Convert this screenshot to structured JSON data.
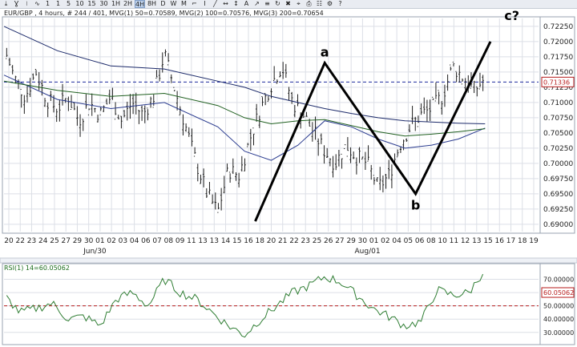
{
  "toolbar": {
    "items": [
      {
        "label": "⤓",
        "name": "download-icon",
        "interactable": true
      },
      {
        "label": "Ɣ",
        "name": "candle-type-icon",
        "interactable": true
      },
      {
        "label": "⧘",
        "name": "bar-type-icon",
        "interactable": true
      },
      {
        "label": "∿",
        "name": "line-type-icon",
        "interactable": true
      },
      {
        "label": "1",
        "name": "timeframe-1"
      },
      {
        "label": "1",
        "name": "timeframe-1b"
      },
      {
        "label": "5",
        "name": "timeframe-5"
      },
      {
        "label": "10",
        "name": "timeframe-10"
      },
      {
        "label": "15",
        "name": "timeframe-15"
      },
      {
        "label": "30",
        "name": "timeframe-30"
      },
      {
        "label": "1H",
        "name": "timeframe-1h"
      },
      {
        "label": "2H",
        "name": "timeframe-2h"
      },
      {
        "label": "4H",
        "name": "timeframe-4h",
        "active": true
      },
      {
        "label": "8H",
        "name": "timeframe-8h"
      },
      {
        "label": "D",
        "name": "timeframe-d"
      },
      {
        "label": "W",
        "name": "timeframe-w"
      },
      {
        "label": "M",
        "name": "timeframe-m"
      },
      {
        "label": "⌐",
        "name": "crosshair-icon"
      },
      {
        "label": "I",
        "name": "cursor-icon"
      },
      {
        "label": "╱",
        "name": "trendline-icon"
      },
      {
        "label": "↔",
        "name": "hline-icon"
      },
      {
        "label": "↕",
        "name": "vline-icon"
      },
      {
        "label": "A",
        "name": "text-tool-icon"
      },
      {
        "label": "↗",
        "name": "arrow-tool-icon"
      },
      {
        "label": "≡",
        "name": "fib-icon"
      },
      {
        "label": "↻",
        "name": "refresh-icon"
      },
      {
        "label": "✖",
        "name": "delete-icon"
      },
      {
        "label": "⌖",
        "name": "target-icon"
      },
      {
        "label": "⎙",
        "name": "print-icon"
      },
      {
        "label": "☷",
        "name": "grid-icon"
      },
      {
        "label": "⚙",
        "name": "settings-icon"
      },
      {
        "label": "?",
        "name": "help-icon"
      }
    ]
  },
  "colors": {
    "price": "#1c1c1c",
    "ma_blue": "#2a3b8f",
    "ma_green": "#1f5f1f",
    "ma_navy": "#1c2a6a",
    "rsi_line": "#2e7d32",
    "rsi_level": "#b71c1c",
    "last_price_line": "#1f2a9e",
    "price_tag": "#b71c1c",
    "grid": "#dcdfe6",
    "axis_bg": "#ffffff"
  },
  "chart_data": [
    {
      "type": "line",
      "title": "EUR/GBP , 4 hours, # 244 / 401, MVG(1) 50=0.70589, MVG(2) 100=0.70576, MVG(3) 200=0.70654",
      "yticks": [
        0.69,
        0.6925,
        0.695,
        0.6975,
        0.7,
        0.7025,
        0.705,
        0.7075,
        0.71,
        0.7125,
        0.715,
        0.7175,
        0.72,
        0.7225
      ],
      "ytick_labels": [
        "0.69000",
        "0.69250",
        "0.69500",
        "0.69750",
        "0.70000",
        "0.70250",
        "0.70500",
        "0.70750",
        "0.71000",
        "0.71250",
        "0.71500",
        "0.71750",
        "0.72000",
        "0.72250"
      ],
      "ylim": [
        0.6888,
        0.7238
      ],
      "xlim": [
        0,
        100
      ],
      "x_day_labels": [
        "20",
        "22",
        "23",
        "24",
        "25",
        "27",
        "29",
        "30",
        "01",
        "02",
        "03",
        "04",
        "06",
        "07",
        "08",
        "09",
        "11",
        "13",
        "13",
        "14",
        "15",
        "16",
        "18",
        "20",
        "21",
        "22",
        "23",
        "25",
        "26",
        "27",
        "29",
        "30",
        "01",
        "02",
        "04",
        "05",
        "06",
        "08",
        "10",
        "11",
        "12",
        "13",
        "15",
        "16",
        "17",
        "18",
        "19"
      ],
      "x_month_labels": [
        {
          "label": "Jun/30",
          "x": 17
        },
        {
          "label": "Aug/01",
          "x": 68
        }
      ],
      "last_price": 0.71336,
      "last_price_label": "0.71336",
      "series": [
        {
          "name": "EUR/GBP",
          "style": "ohlc",
          "x": [
            0,
            2,
            4,
            6,
            8,
            10,
            12,
            14,
            16,
            18,
            20,
            22,
            24,
            26,
            28,
            30,
            32,
            34,
            36,
            38,
            40,
            42,
            44,
            46,
            48,
            50,
            52,
            54,
            56,
            58,
            60,
            62,
            64,
            66,
            68,
            70,
            72,
            74,
            76,
            78,
            80,
            82,
            84,
            86,
            88,
            90
          ],
          "close": [
            0.719,
            0.714,
            0.711,
            0.715,
            0.7105,
            0.709,
            0.711,
            0.707,
            0.71,
            0.708,
            0.711,
            0.707,
            0.71,
            0.708,
            0.711,
            0.718,
            0.712,
            0.706,
            0.7,
            0.695,
            0.692,
            0.699,
            0.698,
            0.704,
            0.709,
            0.713,
            0.716,
            0.71,
            0.708,
            0.705,
            0.702,
            0.7,
            0.703,
            0.701,
            0.7,
            0.696,
            0.698,
            0.703,
            0.706,
            0.708,
            0.709,
            0.711,
            0.716,
            0.714,
            0.712,
            0.714
          ]
        },
        {
          "name": "MVG(1) 50",
          "x": [
            0,
            10,
            20,
            30,
            40,
            45,
            50,
            55,
            60,
            65,
            70,
            75,
            80,
            85,
            90
          ],
          "y": [
            0.7145,
            0.7105,
            0.709,
            0.71,
            0.706,
            0.702,
            0.7005,
            0.703,
            0.707,
            0.706,
            0.704,
            0.7025,
            0.703,
            0.704,
            0.7058
          ]
        },
        {
          "name": "MVG(2) 100",
          "x": [
            0,
            10,
            20,
            30,
            40,
            45,
            50,
            55,
            60,
            65,
            70,
            75,
            80,
            85,
            90
          ],
          "y": [
            0.7135,
            0.712,
            0.711,
            0.7115,
            0.7095,
            0.7075,
            0.7065,
            0.707,
            0.7072,
            0.7062,
            0.7052,
            0.7045,
            0.7048,
            0.7052,
            0.7057
          ]
        },
        {
          "name": "MVG(3) 200",
          "x": [
            0,
            10,
            20,
            30,
            40,
            45,
            50,
            55,
            60,
            65,
            70,
            75,
            80,
            85,
            90
          ],
          "y": [
            0.7225,
            0.7185,
            0.716,
            0.7155,
            0.7135,
            0.7125,
            0.711,
            0.71,
            0.709,
            0.7082,
            0.7075,
            0.707,
            0.7068,
            0.7066,
            0.7065
          ]
        }
      ],
      "annotations": [
        {
          "label": "a",
          "x": 60,
          "y": 0.7165
        },
        {
          "label": "b",
          "x": 77,
          "y": 0.6945
        },
        {
          "label": "c?",
          "x": 95,
          "y": 0.7225
        }
      ],
      "wave_lines": {
        "x": [
          47,
          60,
          77,
          91
        ],
        "y": [
          0.6905,
          0.7165,
          0.695,
          0.72
        ]
      }
    },
    {
      "type": "line",
      "title": "RSI(1) 14=60.05062",
      "yticks": [
        30,
        40,
        50,
        60,
        70
      ],
      "ytick_labels": [
        "30.00000",
        "40.00000",
        "50.00000",
        "60.00000",
        "70.00000"
      ],
      "ylim": [
        22,
        80
      ],
      "level": 50,
      "last_value": 60.05062,
      "last_value_label": "60.05062",
      "series": [
        {
          "name": "RSI(1) 14",
          "x": [
            0,
            3,
            6,
            9,
            12,
            15,
            18,
            21,
            24,
            27,
            30,
            33,
            36,
            39,
            42,
            45,
            48,
            51,
            54,
            57,
            60,
            63,
            66,
            69,
            72,
            75,
            78,
            81,
            84,
            87,
            90
          ],
          "y": [
            58,
            45,
            48,
            52,
            40,
            42,
            35,
            55,
            60,
            50,
            70,
            60,
            55,
            45,
            35,
            28,
            40,
            50,
            60,
            65,
            72,
            68,
            58,
            48,
            42,
            35,
            38,
            62,
            58,
            60,
            78
          ]
        }
      ]
    }
  ]
}
